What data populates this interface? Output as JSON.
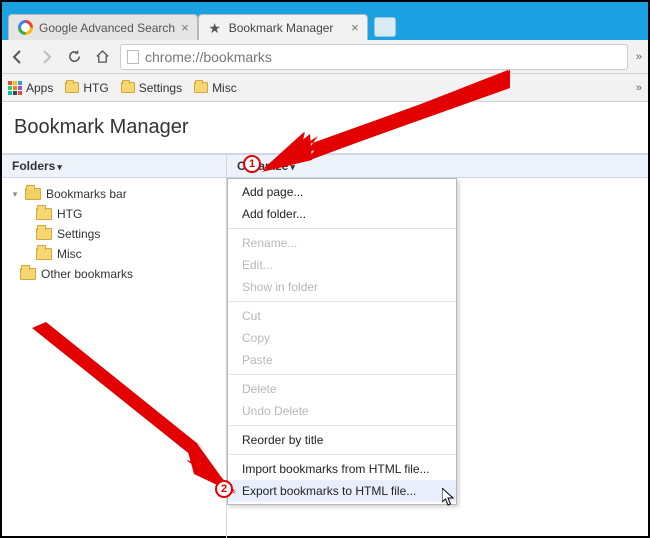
{
  "tabs": [
    {
      "title": "Google Advanced Search",
      "favicon": "google"
    },
    {
      "title": "Bookmark Manager",
      "favicon": "star"
    }
  ],
  "omnibox": {
    "url": "chrome://bookmarks"
  },
  "bookmarks_bar": {
    "apps_label": "Apps",
    "items": [
      "HTG",
      "Settings",
      "Misc"
    ]
  },
  "page": {
    "title": "Bookmark Manager"
  },
  "columns": {
    "folders": "Folders",
    "organize": "Organize"
  },
  "tree": {
    "root": "Bookmarks bar",
    "children": [
      "HTG",
      "Settings",
      "Misc"
    ],
    "other": "Other bookmarks"
  },
  "organize_menu": {
    "add_page": "Add page...",
    "add_folder": "Add folder...",
    "rename": "Rename...",
    "edit": "Edit...",
    "show_in_folder": "Show in folder",
    "cut": "Cut",
    "copy": "Copy",
    "paste": "Paste",
    "delete": "Delete",
    "undo_delete": "Undo Delete",
    "reorder": "Reorder by title",
    "import": "Import bookmarks from HTML file...",
    "export": "Export bookmarks to HTML file..."
  },
  "annotations": {
    "marker1": "1",
    "marker2": "2"
  }
}
